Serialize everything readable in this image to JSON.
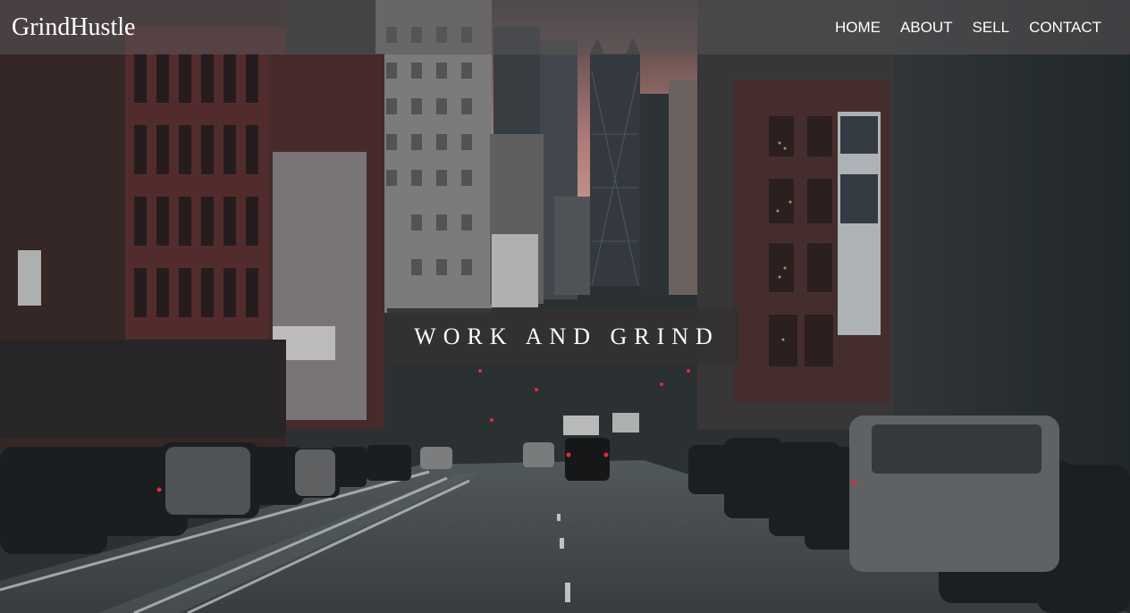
{
  "nav": {
    "brand": "GrindHustle",
    "links": [
      "HOME",
      "ABOUT",
      "SELL",
      "CONTACT"
    ]
  },
  "hero": {
    "banner_text": "WORK AND GRIND",
    "background_image": "city-street-photo"
  },
  "colors": {
    "navbar_bg": "#5a5658",
    "banner_bg": "#343030",
    "text": "#ffffff"
  }
}
